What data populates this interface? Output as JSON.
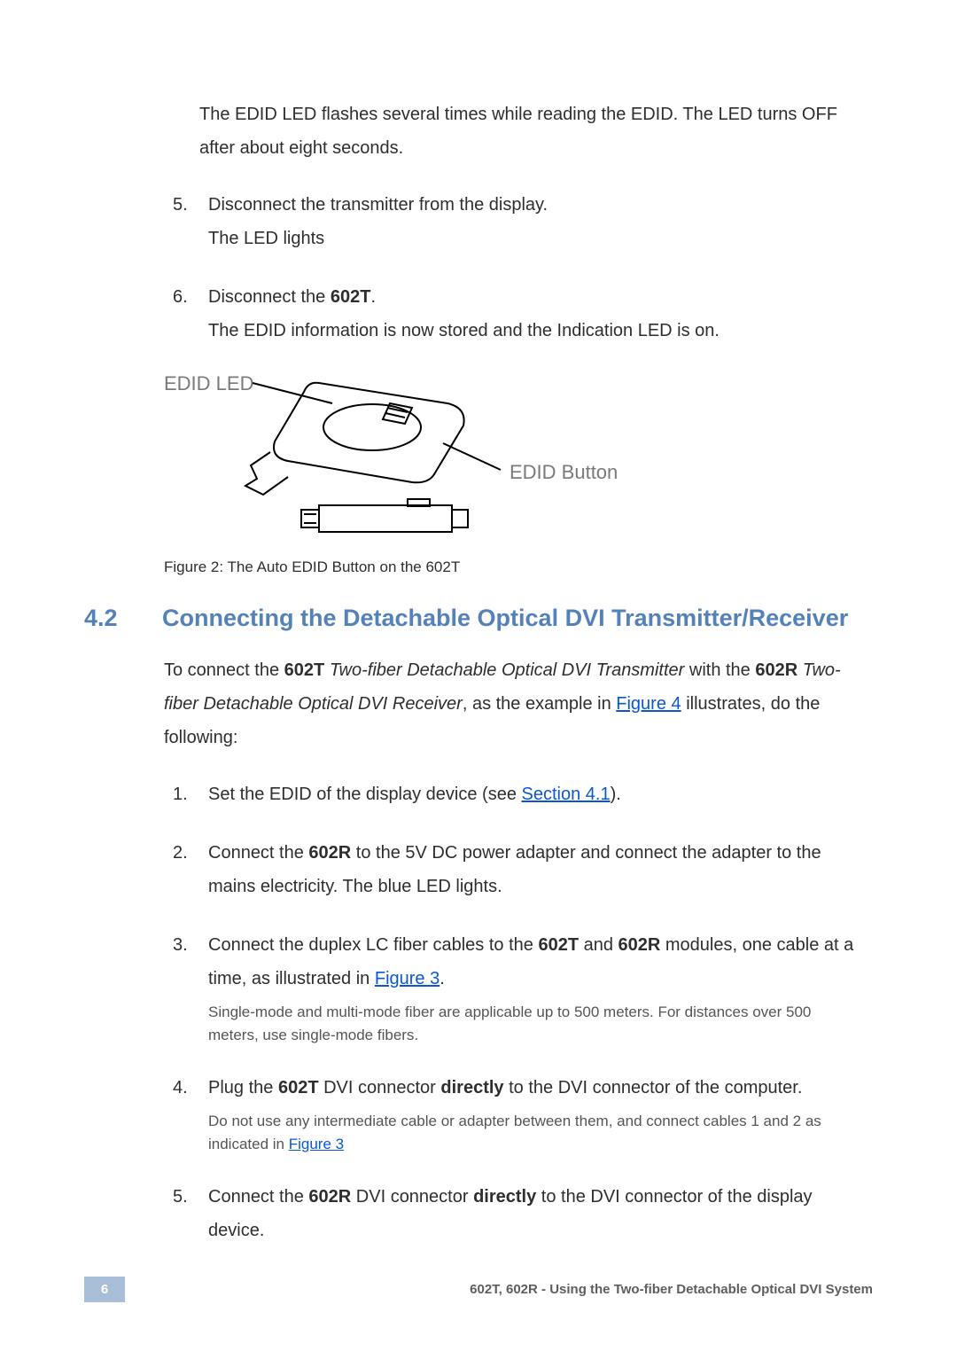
{
  "intro_para": "The EDID LED flashes several times while reading the EDID. The LED turns OFF after about eight seconds.",
  "list_a": {
    "item5": {
      "num": "5.",
      "line1": "Disconnect the transmitter from the display.",
      "line2": "The LED lights"
    },
    "item6": {
      "num": "6.",
      "prefix": "Disconnect the ",
      "bold": "602T",
      "suffix": ".",
      "line2": "The EDID information is now stored and the Indication LED is on."
    }
  },
  "figure": {
    "label_left": "EDID LED",
    "label_right": "EDID Button",
    "caption": "Figure 2: The Auto EDID Button on the 602T"
  },
  "section": {
    "num": "4.2",
    "title": "Connecting the Detachable Optical DVI Transmitter/Receiver"
  },
  "para_b": {
    "t1": "To connect the ",
    "b1": "602T",
    "t2": " ",
    "i1": "Two-fiber Detachable Optical DVI Transmitter",
    "t3": " with the ",
    "b2": "602R",
    "t4": " ",
    "i2": "Two-fiber Detachable Optical DVI Receiver",
    "t5": ", as the example in ",
    "link1": "Figure 4",
    "t6": " illustrates, do the following:"
  },
  "list_b": {
    "item1": {
      "num": "1.",
      "t1": "Set the EDID of the display device (see ",
      "link": "Section 4.1",
      "t2": ")."
    },
    "item2": {
      "num": "2.",
      "t1": "Connect the ",
      "b1": "602R",
      "t2": " to the 5V DC power adapter and connect the adapter to the mains electricity. The blue LED lights."
    },
    "item3": {
      "num": "3.",
      "t1": "Connect the duplex LC fiber cables to the ",
      "b1": "602T",
      "t2": " and ",
      "b2": "602R",
      "t3": " modules, one cable at a time, as illustrated in ",
      "link": "Figure 3",
      "t4": ".",
      "note": "Single-mode and multi-mode fiber are applicable up to 500 meters. For distances over 500 meters, use single-mode fibers."
    },
    "item4": {
      "num": "4.",
      "t1": "Plug the ",
      "b1": "602T",
      "t2": " DVI connector ",
      "b2": "directly",
      "t3": " to the DVI connector of the computer.",
      "note_t1": "Do not use any intermediate cable or adapter between them, and connect cables 1 and 2 as indicated in ",
      "note_link": "Figure 3"
    },
    "item5": {
      "num": "5.",
      "t1": "Connect the ",
      "b1": "602R",
      "t2": " DVI connector ",
      "b2": "directly",
      "t3": " to the DVI connector of the display device."
    }
  },
  "footer": {
    "page": "6",
    "text": "602T, 602R - Using the Two-fiber Detachable Optical DVI System"
  }
}
